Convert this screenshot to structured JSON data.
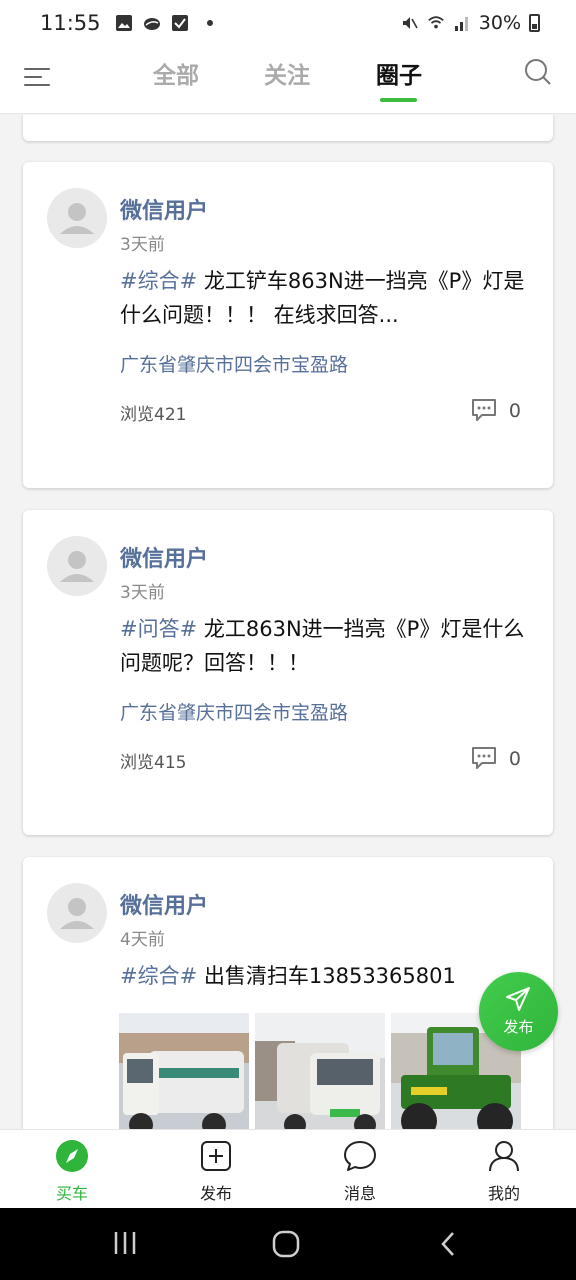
{
  "status_bar": {
    "time": "11:55",
    "battery": "30%"
  },
  "top_nav": {
    "tabs": [
      {
        "label": "全部"
      },
      {
        "label": "关注"
      },
      {
        "label": "圈子"
      }
    ]
  },
  "posts": [
    {
      "user": "微信用户",
      "time": "3天前",
      "tag": "#综合#",
      "text": " 龙工铲车863N进一挡亮《P》灯是什么问题！！！ 在线求回答...",
      "location": "广东省肇庆市四会市宝盈路",
      "views": "浏览421",
      "comments": "0"
    },
    {
      "user": "微信用户",
      "time": "3天前",
      "tag": "#问答#",
      "text": " 龙工863N进一挡亮《P》灯是什么问题呢？回答！！！",
      "location": "广东省肇庆市四会市宝盈路",
      "views": "浏览415",
      "comments": "0"
    },
    {
      "user": "微信用户",
      "time": "4天前",
      "tag": "#综合#",
      "text": " 出售清扫车13853365801"
    }
  ],
  "fab": {
    "label": "发布"
  },
  "bottom_nav": {
    "items": [
      {
        "label": "买车",
        "icon": "compass-icon"
      },
      {
        "label": "发布",
        "icon": "plus-square-icon"
      },
      {
        "label": "消息",
        "icon": "chat-bubble-icon"
      },
      {
        "label": "我的",
        "icon": "person-icon"
      }
    ]
  },
  "colors": {
    "accent": "#2fb53b",
    "link": "#57709a"
  }
}
